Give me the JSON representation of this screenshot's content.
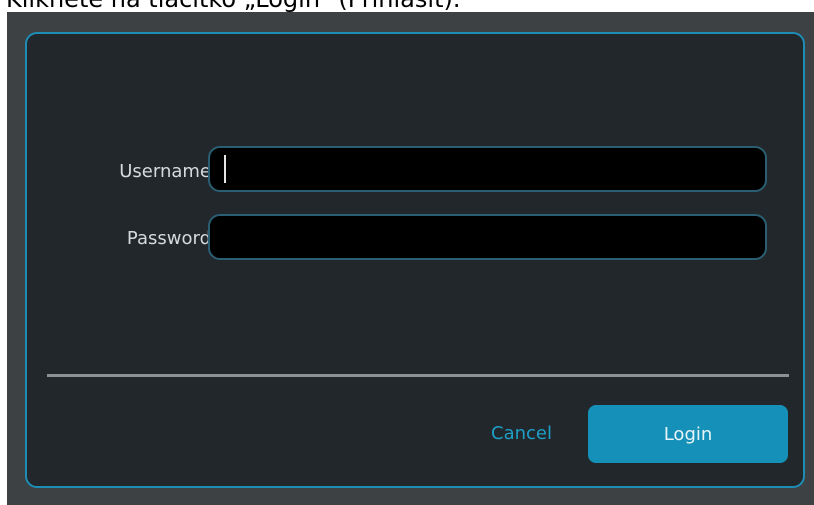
{
  "caption": "Klikněte na tlačítko „Login“ (Přihlásit).",
  "login_form": {
    "username_label": "Username",
    "username_value": "",
    "password_label": "Password",
    "password_value": "",
    "cancel_label": "Cancel",
    "login_label": "Login"
  },
  "colors": {
    "accent": "#1590b8",
    "dialog_background": "#22272b",
    "field_background": "#000000"
  }
}
